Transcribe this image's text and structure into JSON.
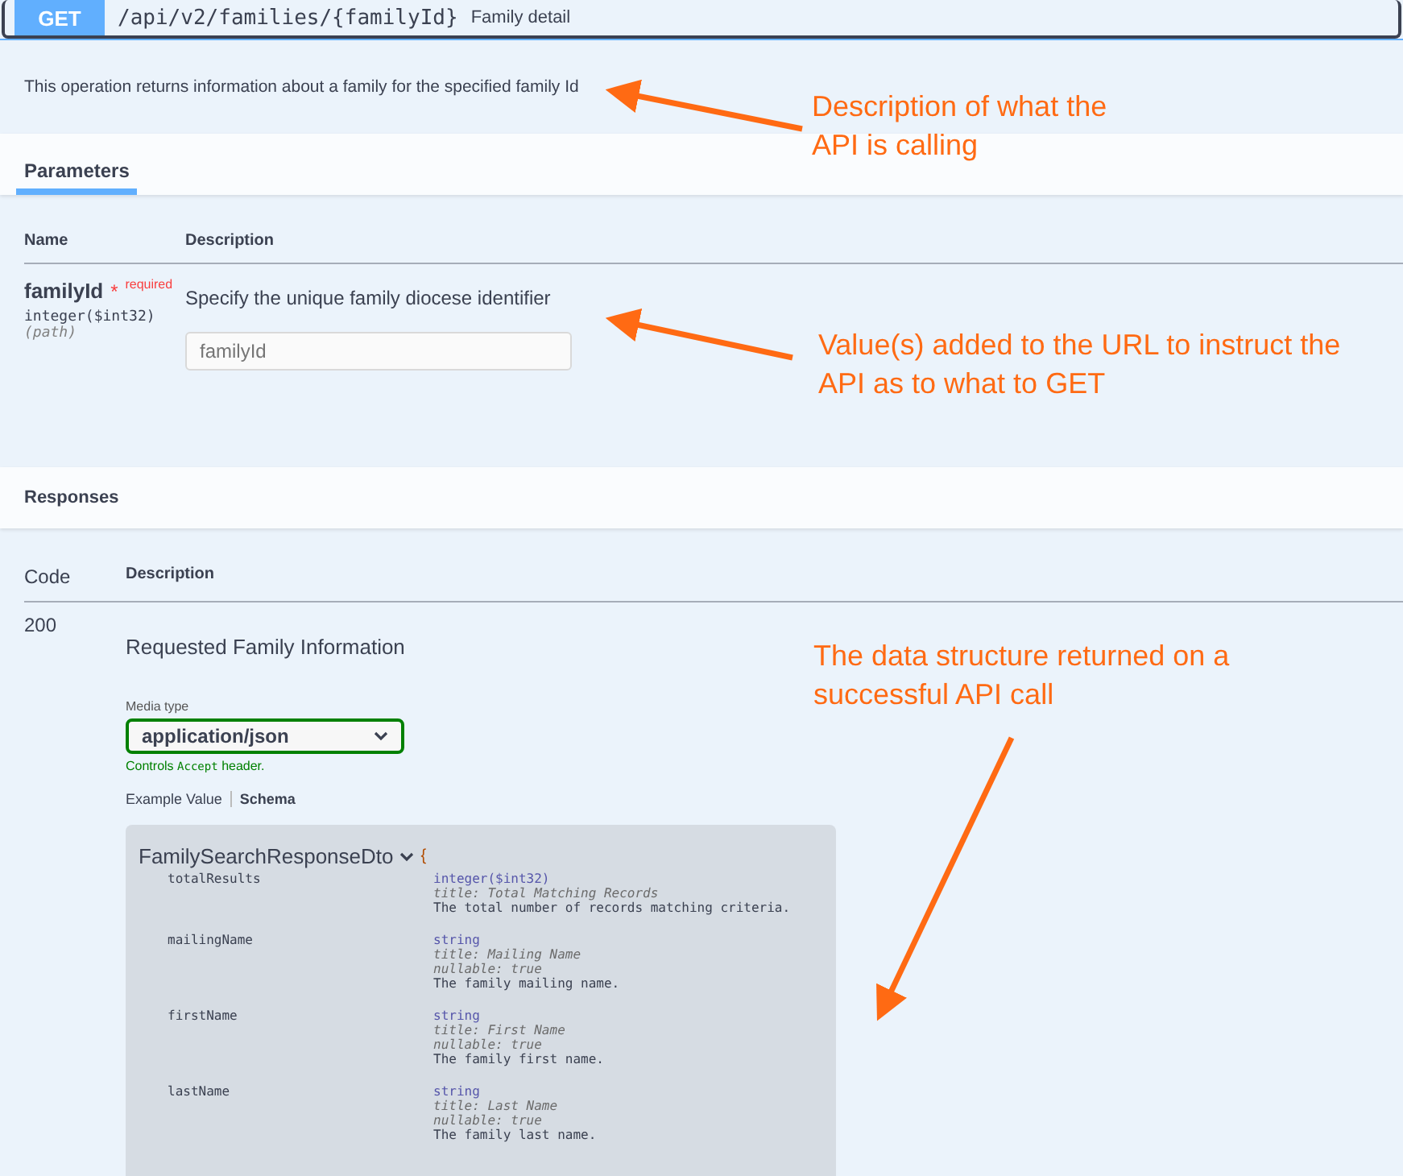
{
  "operation": {
    "method": "GET",
    "path": "/api/v2/families/{familyId}",
    "summary": "Family detail",
    "description": "This operation returns information about a family for the specified family Id"
  },
  "tabs": [
    {
      "label": "Parameters",
      "selected": true
    }
  ],
  "parameters": {
    "columns": [
      "Name",
      "Description"
    ],
    "rows": [
      {
        "name": "familyId",
        "required_mark": "*",
        "required_label": "required",
        "type": "integer($int32)",
        "location": "(path)",
        "description": "Specify the unique family diocese identifier",
        "placeholder": "familyId"
      }
    ]
  },
  "responses": {
    "title": "Responses",
    "columns": [
      "Code",
      "Description"
    ],
    "rows": [
      {
        "code": "200",
        "description": "Requested Family Information",
        "media_type_label": "Media type",
        "media_type": "application/json",
        "controls_prefix": "Controls",
        "controls_code": "Accept",
        "controls_suffix": "header.",
        "example_tabs": [
          {
            "label": "Example Value",
            "selected": false
          },
          {
            "label": "Schema",
            "selected": true
          }
        ],
        "schema": {
          "name": "FamilySearchResponseDto",
          "brace": "{",
          "expanded": true,
          "properties": [
            {
              "name": "totalResults",
              "type": "integer($int32)",
              "title": "title: Total Matching Records",
              "description": "The total number of records matching criteria."
            },
            {
              "name": "mailingName",
              "type": "string",
              "title": "title: Mailing Name",
              "nullable": "nullable: true",
              "description": "The family mailing name."
            },
            {
              "name": "firstName",
              "type": "string",
              "title": "title: First Name",
              "nullable": "nullable: true",
              "description": "The family first name."
            },
            {
              "name": "lastName",
              "type": "string",
              "title": "title: Last Name",
              "nullable": "nullable: true",
              "description": "The family last name."
            }
          ]
        }
      }
    ]
  },
  "annotations": [
    {
      "text": "Description of what the API is calling"
    },
    {
      "text": "Value(s) added to the URL to instruct the API as to what to GET"
    },
    {
      "text": "The data structure returned on a successful API call"
    }
  ]
}
